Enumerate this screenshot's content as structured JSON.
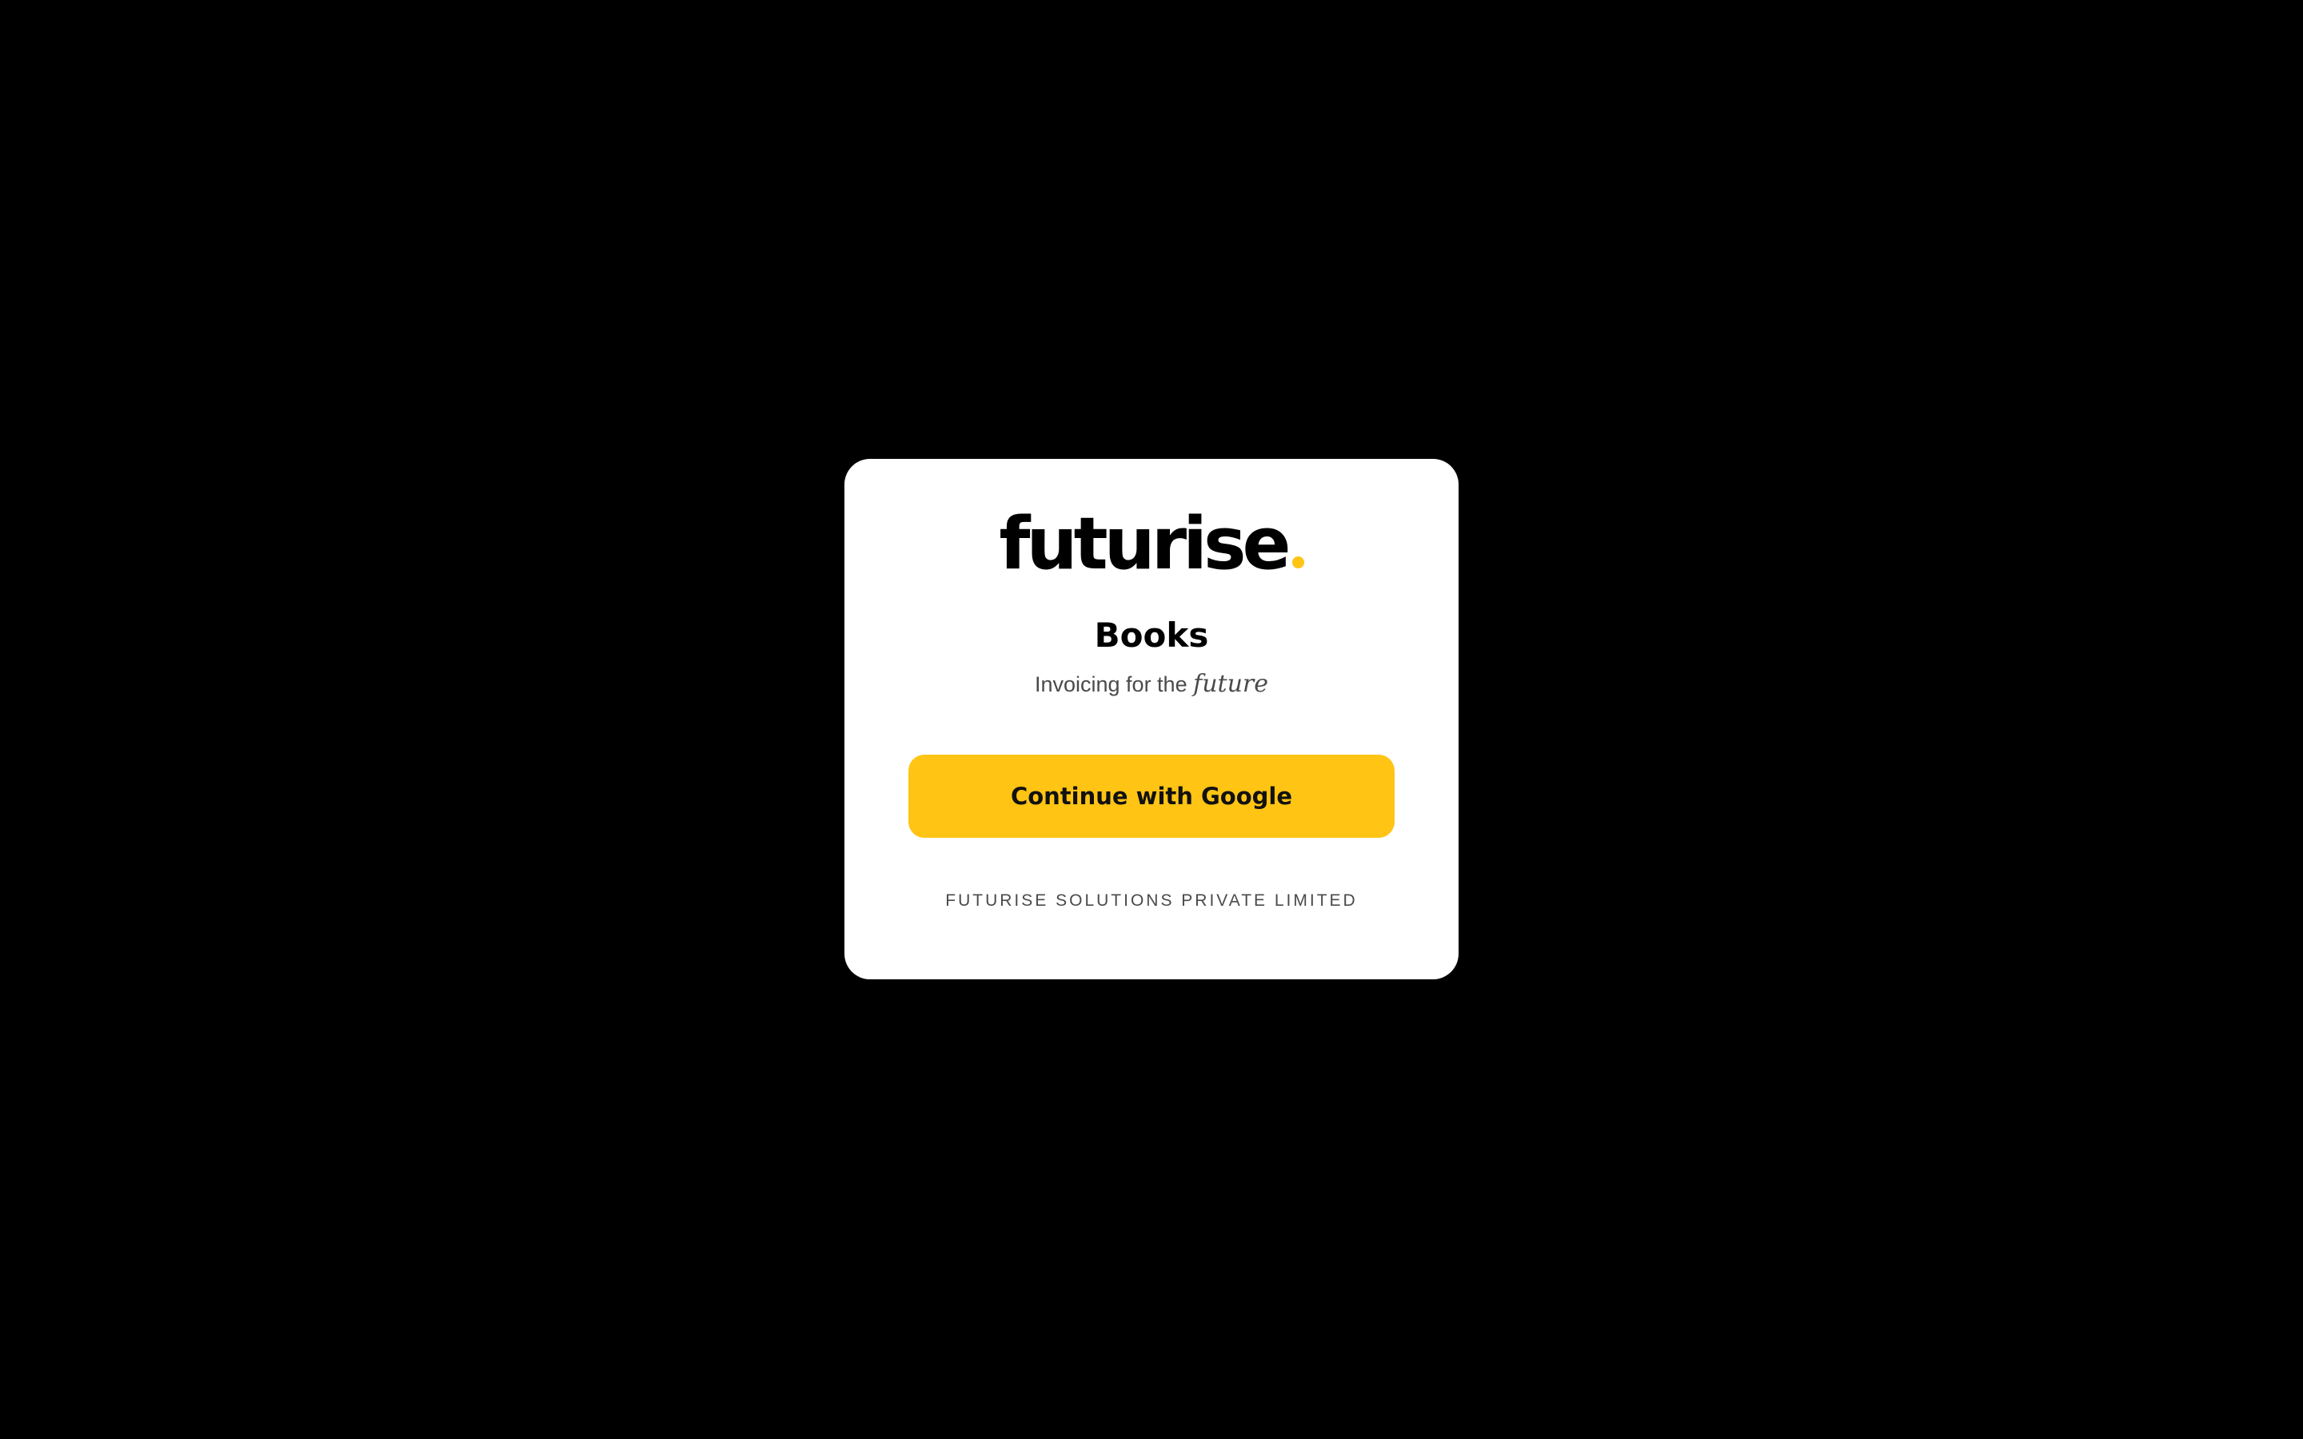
{
  "brand": {
    "logo_text": "futurise",
    "accent_color": "#FFC414"
  },
  "login": {
    "app_title": "Books",
    "tagline_prefix": "Invoicing for the",
    "tagline_emphasis": "future",
    "google_button_label": "Continue with Google"
  },
  "footer": {
    "company_name": "FUTURISE SOLUTIONS PRIVATE LIMITED"
  }
}
